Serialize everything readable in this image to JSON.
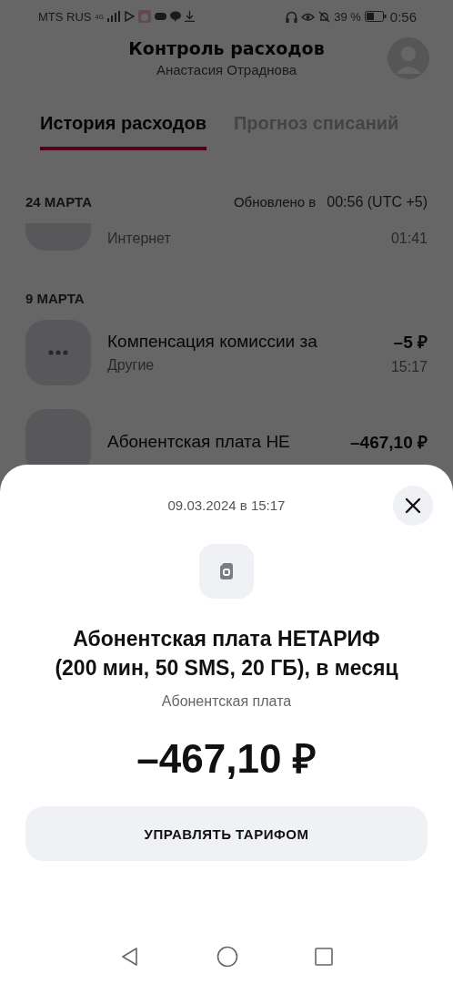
{
  "status_bar": {
    "carrier": "MTS RUS",
    "network": "4G",
    "battery": "39 %",
    "time": "0:56"
  },
  "header": {
    "title": "Контроль расходов",
    "subtitle": "Анастасия Отраднова"
  },
  "tabs": [
    {
      "label": "История расходов",
      "selected": true
    },
    {
      "label": "Прогноз списаний",
      "selected": false
    }
  ],
  "updated": {
    "label": "Обновлено в",
    "time": "00:56 (UTC +5)"
  },
  "groups": [
    {
      "date": "24 МАРТА",
      "items": [
        {
          "category": "Интернет",
          "time": "01:41"
        }
      ]
    },
    {
      "date": "9 МАРТА",
      "items": [
        {
          "title": "Компенсация комиссии за",
          "category": "Другие",
          "amount": "–5 ₽",
          "time": "15:17"
        },
        {
          "title": "Абонентская плата НЕ",
          "amount": "–467,10 ₽"
        }
      ]
    }
  ],
  "sheet": {
    "datetime": "09.03.2024 в 15:17",
    "title": "Абонентская плата НЕТАРИФ (200 мин, 50 SMS, 20 ГБ), в месяц",
    "category": "Абонентская плата",
    "amount": "–467,10 ₽",
    "button": "УПРАВЛЯТЬ ТАРИФОМ"
  }
}
